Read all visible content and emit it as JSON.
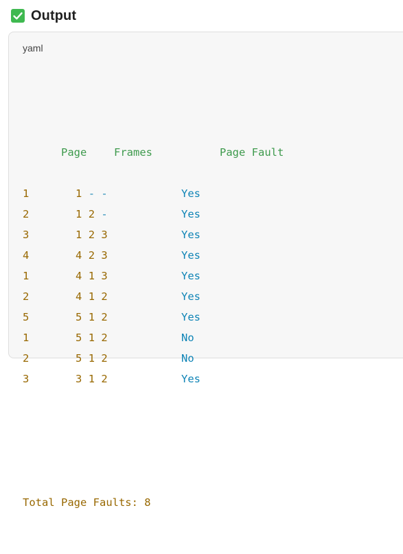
{
  "header": {
    "title": "Output",
    "icon": "check-box-icon",
    "icon_color": "#3fb950"
  },
  "code_block": {
    "language": "yaml",
    "columns": [
      "Page",
      "Frames",
      "Page Fault"
    ],
    "rows": [
      {
        "page": "1",
        "frames": [
          "1",
          "-",
          "-"
        ],
        "fault": "Yes"
      },
      {
        "page": "2",
        "frames": [
          "1",
          "2",
          "-"
        ],
        "fault": "Yes"
      },
      {
        "page": "3",
        "frames": [
          "1",
          "2",
          "3"
        ],
        "fault": "Yes"
      },
      {
        "page": "4",
        "frames": [
          "4",
          "2",
          "3"
        ],
        "fault": "Yes"
      },
      {
        "page": "1",
        "frames": [
          "4",
          "1",
          "3"
        ],
        "fault": "Yes"
      },
      {
        "page": "2",
        "frames": [
          "4",
          "1",
          "2"
        ],
        "fault": "Yes"
      },
      {
        "page": "5",
        "frames": [
          "5",
          "1",
          "2"
        ],
        "fault": "Yes"
      },
      {
        "page": "1",
        "frames": [
          "5",
          "1",
          "2"
        ],
        "fault": "No"
      },
      {
        "page": "2",
        "frames": [
          "5",
          "1",
          "2"
        ],
        "fault": "No"
      },
      {
        "page": "3",
        "frames": [
          "3",
          "1",
          "2"
        ],
        "fault": "Yes"
      }
    ],
    "summary": "Total Page Faults: 8"
  }
}
